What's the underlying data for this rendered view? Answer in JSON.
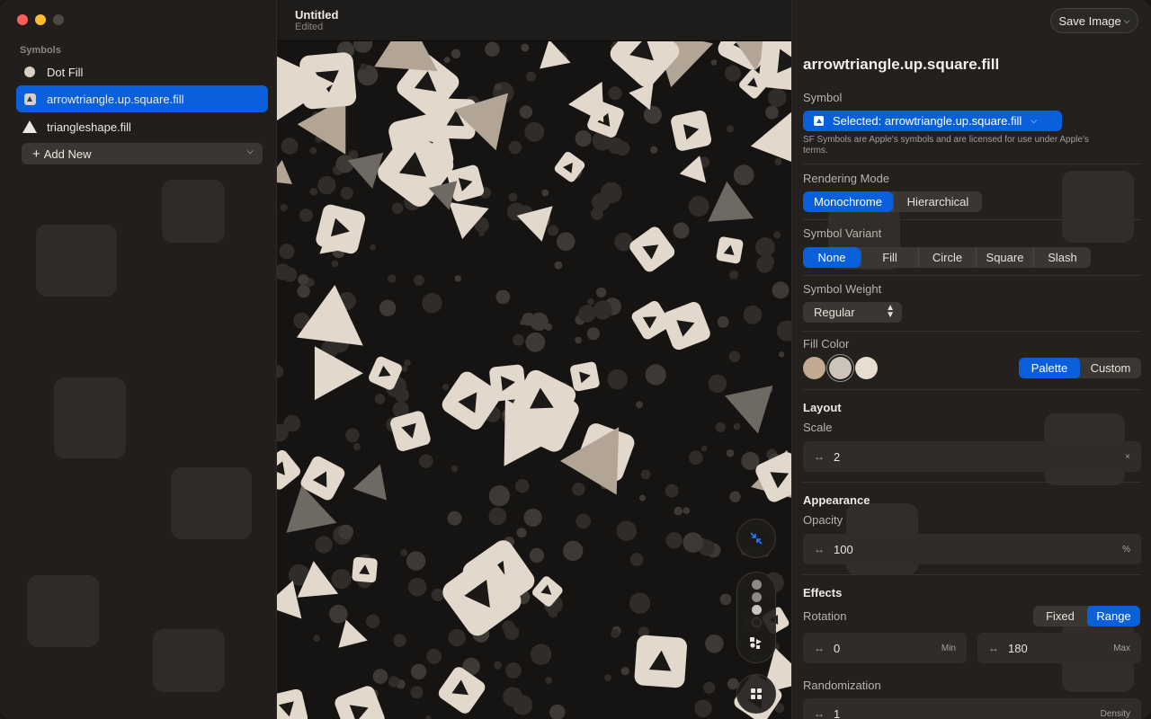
{
  "window": {
    "title": "Untitled",
    "subtitle": "Edited"
  },
  "sidebar": {
    "section_label": "Symbols",
    "items": [
      {
        "label": "Dot Fill",
        "icon": "circle-fill-icon",
        "selected": false
      },
      {
        "label": "arrowtriangle.up.square.fill",
        "icon": "arrowtriangle-square-icon",
        "selected": true
      },
      {
        "label": "triangleshape.fill",
        "icon": "triangle-fill-icon",
        "selected": false
      }
    ],
    "add_new_label": "Add New"
  },
  "toolbar": {
    "save_label": "Save Image"
  },
  "inspector": {
    "title": "arrowtriangle.up.square.fill",
    "symbol": {
      "label": "Symbol",
      "selected_value": "Selected: arrowtriangle.up.square.fill",
      "note": "SF Symbols are Apple's symbols and are licensed for use under Apple's terms."
    },
    "rendering_mode": {
      "label": "Rendering Mode",
      "options": [
        "Monochrome",
        "Hierarchical"
      ],
      "selected": "Monochrome"
    },
    "symbol_variant": {
      "label": "Symbol Variant",
      "options": [
        "None",
        "Fill",
        "Circle",
        "Square",
        "Slash"
      ],
      "selected": "None"
    },
    "symbol_weight": {
      "label": "Symbol Weight",
      "value": "Regular"
    },
    "fill_color": {
      "label": "Fill Color",
      "swatches": [
        "#c2aa92",
        "#cdc4b9",
        "#e8ddd1"
      ],
      "selected_swatch": 1,
      "mode_options": [
        "Palette",
        "Custom"
      ],
      "mode_selected": "Palette"
    },
    "layout": {
      "header": "Layout",
      "scale_label": "Scale",
      "scale_value": "2",
      "scale_suffix": "×"
    },
    "appearance": {
      "header": "Appearance",
      "opacity_label": "Opacity",
      "opacity_value": "100",
      "opacity_suffix": "%"
    },
    "effects": {
      "header": "Effects",
      "rotation_label": "Rotation",
      "rotation_modes": [
        "Fixed",
        "Range"
      ],
      "rotation_mode_selected": "Range",
      "rotation_min": "0",
      "rotation_min_suffix": "Min",
      "rotation_max": "180",
      "rotation_max_suffix": "Max",
      "randomization_label": "Randomization",
      "randomization_value": "1",
      "randomization_suffix": "Density"
    }
  },
  "colors": {
    "accent": "#0a5fdb",
    "pattern_light": "#e3d8cc",
    "pattern_mid": "#b3a596",
    "pattern_dark": "#6f6963",
    "pattern_bg": "#161412"
  }
}
